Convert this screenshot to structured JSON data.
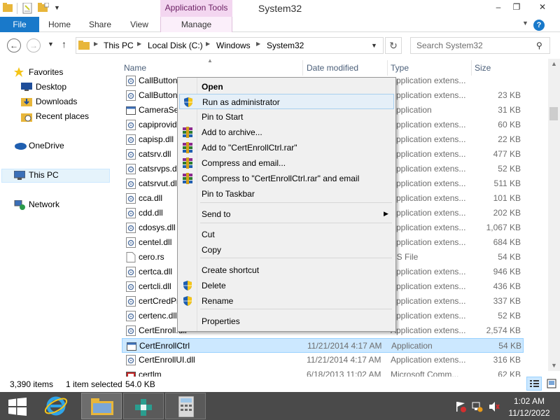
{
  "window": {
    "title": "System32",
    "contextual_tab_group": "Application Tools",
    "buttons": {
      "minimize": "–",
      "maximize": "❐",
      "close": "✕"
    }
  },
  "ribbon": {
    "tabs": [
      {
        "label": "File"
      },
      {
        "label": "Home"
      },
      {
        "label": "Share"
      },
      {
        "label": "View"
      },
      {
        "label": "Manage"
      }
    ],
    "help": "?"
  },
  "address": {
    "crumbs": [
      "This PC",
      "Local Disk (C:)",
      "Windows",
      "System32"
    ],
    "search_placeholder": "Search System32"
  },
  "nav_pane": {
    "favorites": "Favorites",
    "favorites_items": [
      "Desktop",
      "Downloads",
      "Recent places"
    ],
    "onedrive": "OneDrive",
    "this_pc": "This PC",
    "network": "Network"
  },
  "columns": {
    "name": "Name",
    "date": "Date modified",
    "type": "Type",
    "size": "Size"
  },
  "files": [
    {
      "name": "CallButtons",
      "date": "",
      "type": "Application extens...",
      "size": "",
      "icon": "dll-icon"
    },
    {
      "name": "CallButtons.ProxyStub.dll",
      "date": "",
      "type": "Application extens...",
      "size": "23 KB",
      "icon": "dll-icon"
    },
    {
      "name": "CameraSettingsUIHost",
      "date": "",
      "type": "Application",
      "size": "31 KB",
      "icon": "exe-icon"
    },
    {
      "name": "capiprovider.dll",
      "date": "",
      "type": "Application extens...",
      "size": "60 KB",
      "icon": "dll-icon"
    },
    {
      "name": "capisp.dll",
      "date": "",
      "type": "Application extens...",
      "size": "22 KB",
      "icon": "dll-icon"
    },
    {
      "name": "catsrv.dll",
      "date": "",
      "type": "Application extens...",
      "size": "477 KB",
      "icon": "dll-icon"
    },
    {
      "name": "catsrvps.dll",
      "date": "",
      "type": "Application extens...",
      "size": "52 KB",
      "icon": "dll-icon"
    },
    {
      "name": "catsrvut.dll",
      "date": "",
      "type": "Application extens...",
      "size": "511 KB",
      "icon": "dll-icon"
    },
    {
      "name": "cca.dll",
      "date": "",
      "type": "Application extens...",
      "size": "101 KB",
      "icon": "dll-icon"
    },
    {
      "name": "cdd.dll",
      "date": "",
      "type": "Application extens...",
      "size": "202 KB",
      "icon": "dll-icon"
    },
    {
      "name": "cdosys.dll",
      "date": "",
      "type": "Application extens...",
      "size": "1,067 KB",
      "icon": "dll-icon"
    },
    {
      "name": "centel.dll",
      "date": "",
      "type": "Application extens...",
      "size": "684 KB",
      "icon": "dll-icon"
    },
    {
      "name": "cero.rs",
      "date": "",
      "type": "RS File",
      "size": "54 KB",
      "icon": "file-icon"
    },
    {
      "name": "certca.dll",
      "date": "",
      "type": "Application extens...",
      "size": "946 KB",
      "icon": "dll-icon"
    },
    {
      "name": "certcli.dll",
      "date": "",
      "type": "Application extens...",
      "size": "436 KB",
      "icon": "dll-icon"
    },
    {
      "name": "certCredProvider.dll",
      "date": "",
      "type": "Application extens...",
      "size": "337 KB",
      "icon": "dll-icon"
    },
    {
      "name": "certenc.dll",
      "date": "",
      "type": "Application extens...",
      "size": "52 KB",
      "icon": "dll-icon"
    },
    {
      "name": "CertEnroll.dll",
      "date": "",
      "type": "Application extens...",
      "size": "2,574 KB",
      "icon": "dll-icon"
    },
    {
      "name": "CertEnrollCtrl",
      "date": "11/21/2014 4:17 AM",
      "type": "Application",
      "size": "54 KB",
      "icon": "exe-icon",
      "selected": true
    },
    {
      "name": "CertEnrollUI.dll",
      "date": "11/21/2014 4:17 AM",
      "type": "Application extens...",
      "size": "316 KB",
      "icon": "dll-icon"
    },
    {
      "name": "certlm",
      "date": "6/18/2013 11:02 AM",
      "type": "Microsoft Comm...",
      "size": "62 KB",
      "icon": "msc-icon"
    }
  ],
  "status": {
    "items": "3,390 items",
    "selected": "1 item selected",
    "size": "54.0 KB"
  },
  "context_menu": {
    "items": [
      {
        "label": "Open",
        "bold": true
      },
      {
        "label": "Run as administrator",
        "icon": "uac-shield-icon",
        "highlighted": true
      },
      {
        "label": "Pin to Start"
      },
      {
        "label": "Add to archive...",
        "icon": "winrar-icon"
      },
      {
        "label": "Add to \"CertEnrollCtrl.rar\"",
        "icon": "winrar-icon"
      },
      {
        "label": "Compress and email...",
        "icon": "winrar-icon"
      },
      {
        "label": "Compress to \"CertEnrollCtrl.rar\" and email",
        "icon": "winrar-icon"
      },
      {
        "label": "Pin to Taskbar"
      },
      {
        "label": "Send to",
        "submenu": true
      },
      {
        "label": "Cut"
      },
      {
        "label": "Copy"
      },
      {
        "label": "Create shortcut"
      },
      {
        "label": "Delete",
        "icon": "uac-shield-icon"
      },
      {
        "label": "Rename",
        "icon": "uac-shield-icon"
      },
      {
        "label": "Properties"
      }
    ]
  },
  "taskbar": {
    "time": "1:02 AM",
    "date": "11/12/2022"
  },
  "colors": {
    "accent": "#1979ca",
    "selection": "#cce8ff",
    "app_tools": "#f3d6f0",
    "taskbar": "#4a4a4a"
  }
}
